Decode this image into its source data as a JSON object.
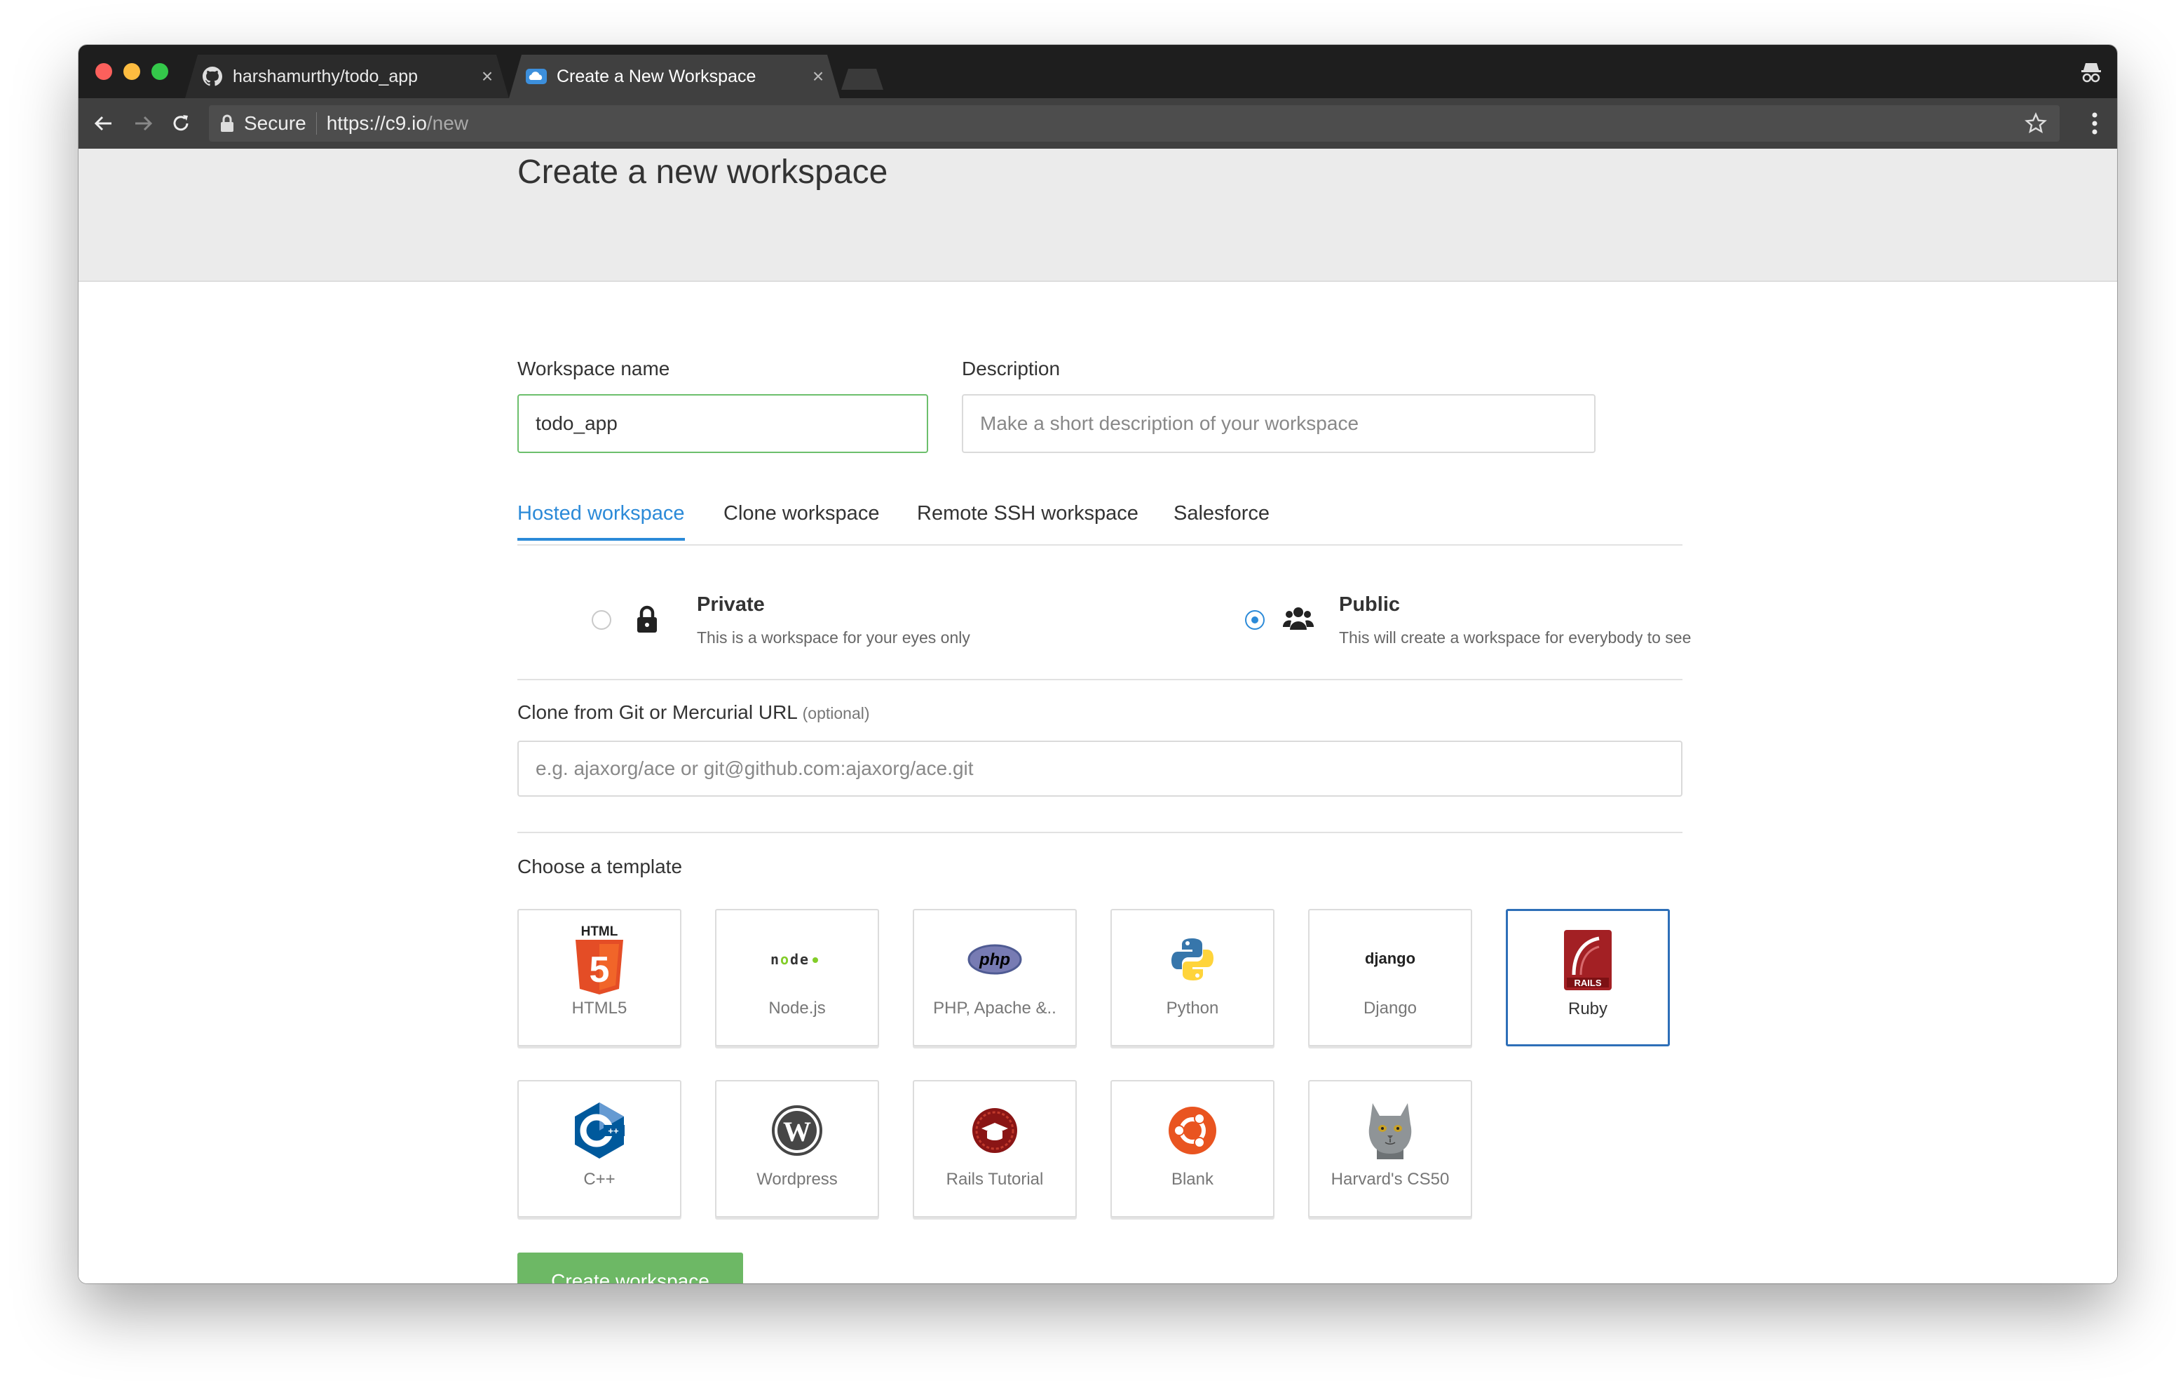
{
  "browser": {
    "tabs": [
      {
        "title": "harshamurthy/todo_app",
        "icon": "github-icon",
        "active": false
      },
      {
        "title": "Create a New Workspace",
        "icon": "cloud9-icon",
        "active": true
      }
    ],
    "address": {
      "secure_label": "Secure",
      "url_host": "https://c9.io",
      "url_path": "/new"
    }
  },
  "page": {
    "title": "Create a new workspace",
    "workspace_name": {
      "label": "Workspace name",
      "value": "todo_app"
    },
    "description": {
      "label": "Description",
      "placeholder": "Make a short description of your workspace"
    },
    "tabs": [
      {
        "label": "Hosted workspace",
        "active": true
      },
      {
        "label": "Clone workspace",
        "active": false
      },
      {
        "label": "Remote SSH workspace",
        "active": false
      },
      {
        "label": "Salesforce",
        "active": false
      }
    ],
    "visibility": {
      "private": {
        "title": "Private",
        "desc": "This is a workspace for your eyes only",
        "checked": false
      },
      "public": {
        "title": "Public",
        "desc": "This will create a workspace for everybody to see",
        "checked": true
      }
    },
    "clone": {
      "label": "Clone from Git or Mercurial URL",
      "optional": "(optional)",
      "placeholder": "e.g. ajaxorg/ace or git@github.com:ajaxorg/ace.git"
    },
    "templates": {
      "label": "Choose a template",
      "items": [
        {
          "label": "HTML5",
          "icon": "html5-icon"
        },
        {
          "label": "Node.js",
          "icon": "nodejs-icon"
        },
        {
          "label": "PHP, Apache &..",
          "icon": "php-icon"
        },
        {
          "label": "Python",
          "icon": "python-icon"
        },
        {
          "label": "Django",
          "icon": "django-icon"
        },
        {
          "label": "Ruby",
          "icon": "rails-icon",
          "selected": true
        },
        {
          "label": "C++",
          "icon": "cpp-icon"
        },
        {
          "label": "Wordpress",
          "icon": "wordpress-icon"
        },
        {
          "label": "Rails Tutorial",
          "icon": "rails-tutorial-icon"
        },
        {
          "label": "Blank",
          "icon": "ubuntu-icon"
        },
        {
          "label": "Harvard's CS50",
          "icon": "cs50-cat-icon"
        }
      ]
    },
    "create_button": "Create workspace",
    "colors": {
      "accent": "#2b8ad8",
      "create": "#6db865",
      "selected_border": "#2e6fb8",
      "focus_border": "#6cbf6c"
    }
  }
}
